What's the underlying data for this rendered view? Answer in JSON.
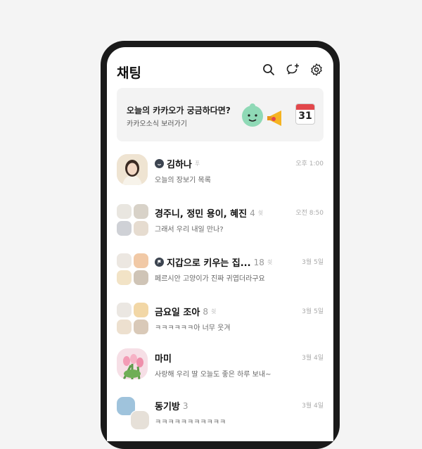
{
  "header": {
    "title": "채팅",
    "icons": [
      "search-icon",
      "new-chat-icon",
      "settings-icon"
    ]
  },
  "banner": {
    "title": "오늘의 카카오가 궁금하다면?",
    "subtitle": "카카오소식 보러가기",
    "calendar_day": "31"
  },
  "chats": [
    {
      "name": "김하나",
      "badge": "me-badge",
      "pin": "푸",
      "message": "오늘의 장보기 목록",
      "time": "오후 1:00"
    },
    {
      "name": "경주니, 정민 용이, 혜진",
      "count": "4",
      "mute": "쉿",
      "message": "그래서 우리 내일 만나?",
      "time": "오전 8:50"
    },
    {
      "name": "지갑으로 키우는 집...",
      "badge": "open-chat-badge",
      "count": "18",
      "mute": "쉿",
      "message": "페르시안 고양이가 진짜 귀엽더라구요",
      "time": "3월 5일"
    },
    {
      "name": "금요일 조아",
      "count": "8",
      "mute": "쉿",
      "message": "ㅋㅋㅋㅋㅋㅋ아 너무 웃겨",
      "time": "3월 5일"
    },
    {
      "name": "마미",
      "message": "사랑해 우리 딸 오늘도 좋은 하루 보내~",
      "time": "3월 4일"
    },
    {
      "name": "동기방",
      "count": "3",
      "message": "ㅋㅋㅋㅋㅋㅋㅋㅋㅋㅋㅋ",
      "time": "3월 4일"
    }
  ]
}
